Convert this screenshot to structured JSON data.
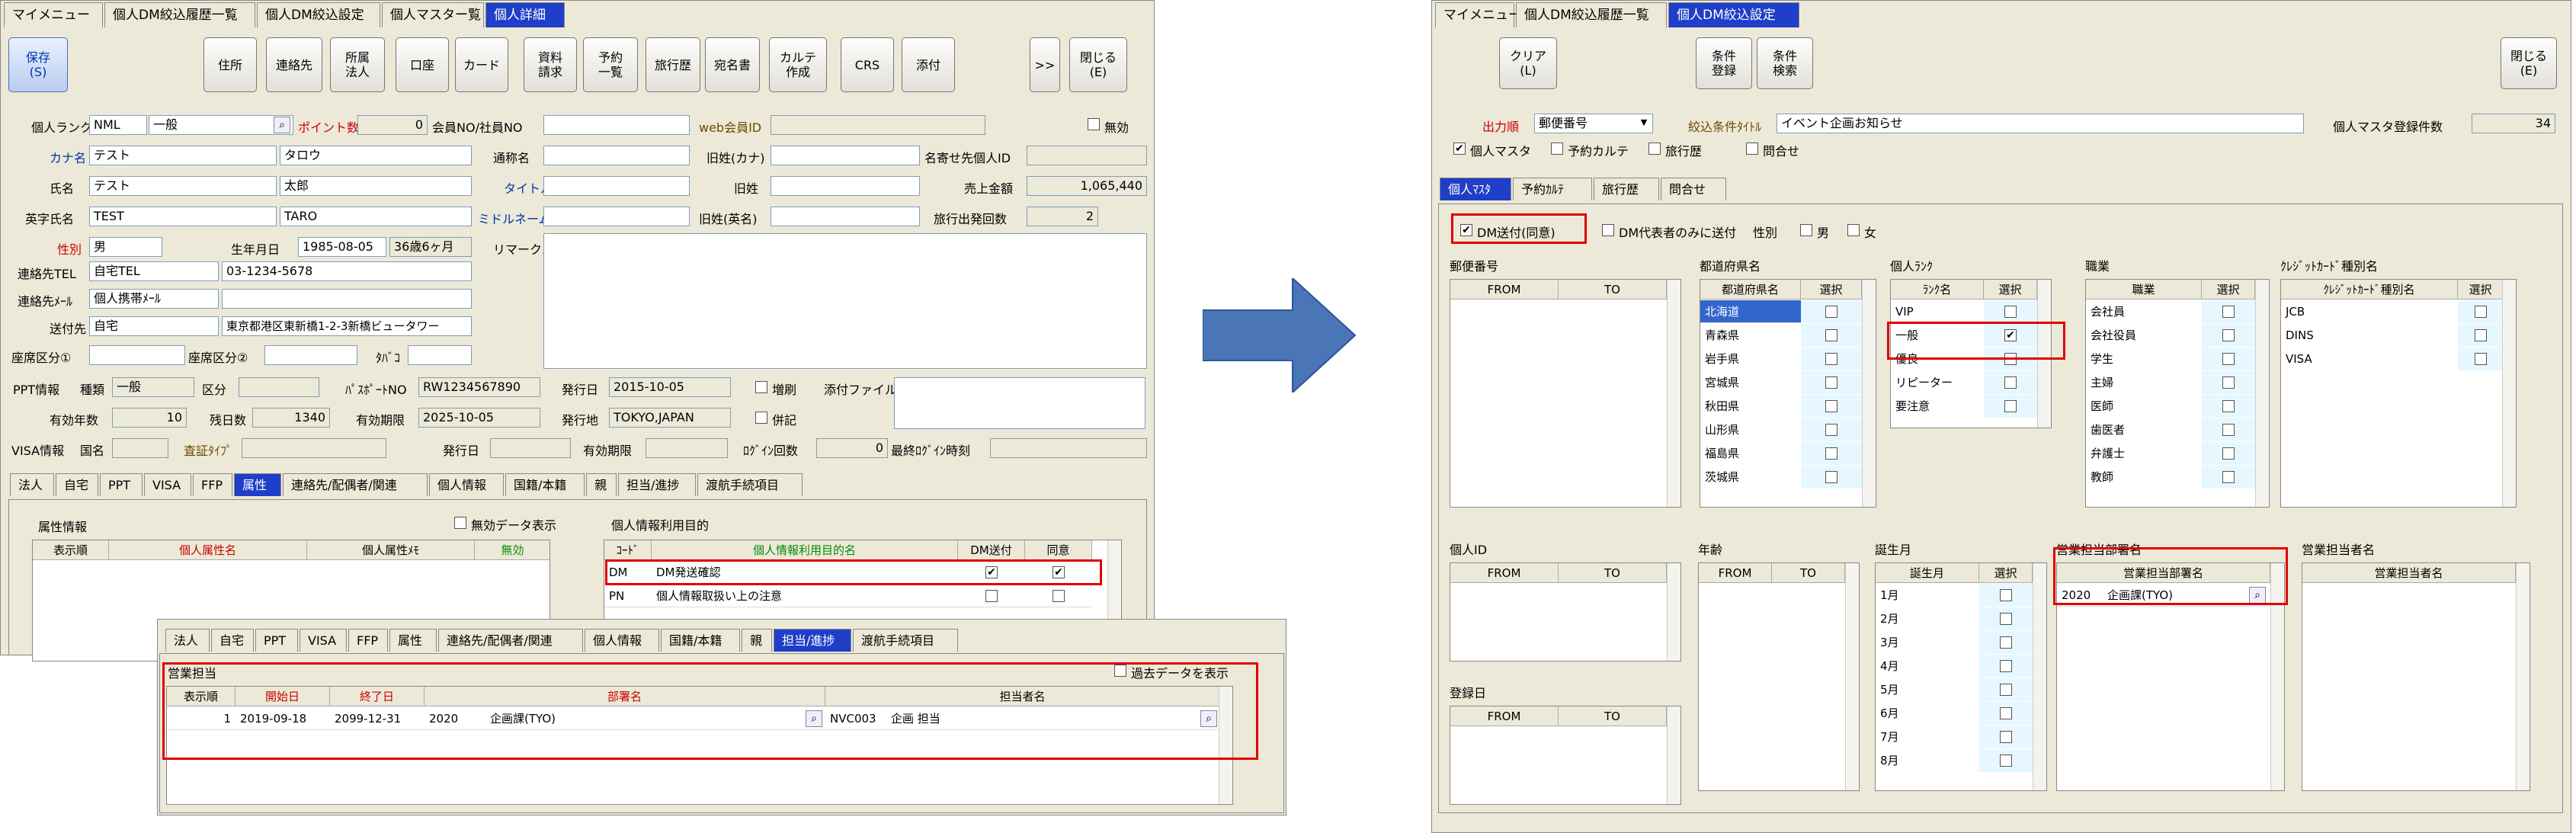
{
  "left": {
    "tabs": [
      "マイメニュー",
      "個人DM絞込履歴一覧",
      "個人DM絞込設定",
      "個人マスター覧",
      "個人詳細"
    ],
    "save": "保存\n(S)",
    "toolbar": [
      "住所",
      "連絡先",
      "所属\n法人",
      "口座",
      "カード",
      "資料\n請求",
      "予約\n一覧",
      "旅行歴",
      "宛名書",
      "カルテ\n作成",
      "CRS",
      "添付",
      ">>",
      "閉じる\n(E)"
    ],
    "form": {
      "rank_label": "個人ランク",
      "rank_code": "NML",
      "rank_name": "一般",
      "point_label": "ポイント数",
      "point_value": "0",
      "member_label": "会員NO/社員NO",
      "web_label": "web会員ID",
      "invalid_label": "無効",
      "kana_label": "カナ名",
      "kana_last": "テスト",
      "kana_first": "タロウ",
      "alias_label": "通称名",
      "old_kana_label": "旧姓(カナ)",
      "nayose_label": "名寄せ先個人ID",
      "name_label": "氏名",
      "name_last": "テスト",
      "name_first": "太郎",
      "title_label": "タイトル",
      "old_label": "旧姓",
      "sales_label": "売上金額",
      "sales_value": "1,065,440",
      "en_label": "英字氏名",
      "en_last": "TEST",
      "en_first": "TARO",
      "middle_label": "ミドルネーム",
      "old_en_label": "旧姓(英名)",
      "travel_label": "旅行出発回数",
      "travel_value": "2",
      "sex_label": "性別",
      "sex_value": "男",
      "birth_label": "生年月日",
      "birth_value": "1985-08-05",
      "age_value": "36歳6ヶ月",
      "remarks_label": "リマークス",
      "tel_label": "連絡先TEL",
      "tel_type": "自宅TEL",
      "tel_value": "03-1234-5678",
      "mail_label": "連絡先ﾒｰﾙ",
      "mail_type": "個人携帯ﾒｰﾙ",
      "send_label": "送付先",
      "send_type": "自宅",
      "send_value": "東京都港区東新橋1-2-3新橋ビュータワー",
      "seat1_label": "座席区分①",
      "seat2_label": "座席区分②",
      "tabako_label": "ﾀﾊﾞｺ",
      "ppt_label": "PPT情報",
      "ppt_kind_label": "種類",
      "ppt_kind": "一般",
      "ppt_cat_label": "区分",
      "passport_label": "ﾊﾟｽﾎﾟｰﾄNO",
      "passport_value": "RW1234567890",
      "issue_label": "発行日",
      "issue_value": "2015-10-05",
      "zoushi_label": "増刷",
      "attach_label": "添付ファイル",
      "years_label": "有効年数",
      "years_value": "10",
      "days_label": "残日数",
      "days_value": "1340",
      "expire_label": "有効期限",
      "expire_value": "2025-10-05",
      "issue_place_label": "発行地",
      "issue_place_value": "TOKYO,JAPAN",
      "heiki_label": "併記",
      "visa_label": "VISA情報",
      "country_label": "国名",
      "visa_type_label": "査証ﾀｲﾌﾟ",
      "visa_issue_label": "発行日",
      "visa_expire_label": "有効期限",
      "login_label": "ﾛｸﾞｲﾝ回数",
      "login_value": "0",
      "last_login_label": "最終ﾛｸﾞｲﾝ時刻"
    },
    "subtabs": [
      "法人",
      "自宅",
      "PPT",
      "VISA",
      "FFP",
      "属性",
      "連絡先/配偶者/関連",
      "個人情報",
      "国籍/本籍",
      "親",
      "担当/進捗",
      "渡航手続項目"
    ],
    "attr": {
      "title": "属性情報",
      "show_invalid": "無効データ表示",
      "cols": [
        "表示順",
        "個人属性名",
        "個人属性ﾒﾓ",
        "無効"
      ]
    },
    "purpose": {
      "title": "個人情報利用目的",
      "cols": [
        "ｺｰﾄﾞ",
        "個人情報利用目的名",
        "DM送付",
        "同意"
      ],
      "rows": [
        {
          "code": "DM",
          "name": "DM発送確認",
          "dm": true,
          "agree": true
        },
        {
          "code": "PN",
          "name": "個人情報取扱い上の注意",
          "dm": false,
          "agree": false
        }
      ]
    }
  },
  "overlay": {
    "subtabs": [
      "法人",
      "自宅",
      "PPT",
      "VISA",
      "FFP",
      "属性",
      "連絡先/配偶者/関連",
      "個人情報",
      "国籍/本籍",
      "親",
      "担当/進捗",
      "渡航手続項目"
    ],
    "title": "営業担当",
    "past": "過去データを表示",
    "cols": [
      "表示順",
      "開始日",
      "終了日",
      "部署名",
      "担当者名"
    ],
    "row": {
      "order": "1",
      "start": "2019-09-18",
      "end": "2099-12-31",
      "dept_code": "2020",
      "dept_name": "企画課(TYO)",
      "staff_code": "NVC003",
      "staff_name": "企画 担当"
    }
  },
  "right": {
    "tabs": [
      "マイメニュー",
      "個人DM絞込履歴一覧",
      "個人DM絞込設定"
    ],
    "clear": "クリア\n(L)",
    "reg": "条件\n登録",
    "search": "条件\n検索",
    "close": "閉じる\n(E)",
    "order_label": "出力順",
    "order_value": "郵便番号",
    "filter_label": "絞込条件ﾀｲﾄﾙ",
    "filter_value": "イベント企画お知らせ",
    "count_label": "個人マスタ登録件数",
    "count_value": "34",
    "checks": [
      {
        "label": "個人マスタ",
        "on": true
      },
      {
        "label": "予約カルテ",
        "on": false
      },
      {
        "label": "旅行歴",
        "on": false
      },
      {
        "label": "問合せ",
        "on": false
      }
    ],
    "subtabs": [
      "個人ﾏｽﾀ",
      "予約ｶﾙﾃ",
      "旅行歴",
      "問合せ"
    ],
    "dm_label": "DM送付(同意)",
    "dm_rep_label": "DM代表者のみに送付",
    "sex_label": "性別",
    "male": "男",
    "female": "女",
    "zip": {
      "title": "郵便番号",
      "cols": [
        "FROM",
        "TO"
      ]
    },
    "pref": {
      "title": "都道府県名",
      "cols": [
        "都道府県名",
        "選択"
      ],
      "rows": [
        "北海道",
        "青森県",
        "岩手県",
        "宮城県",
        "秋田県",
        "山形県",
        "福島県",
        "茨城県"
      ]
    },
    "rank": {
      "title": "個人ﾗﾝｸ",
      "cols": [
        "ﾗﾝｸ名",
        "選択"
      ],
      "rows": [
        {
          "n": "VIP",
          "on": false
        },
        {
          "n": "一般",
          "on": true
        },
        {
          "n": "優良",
          "on": false
        },
        {
          "n": "リピーター",
          "on": false
        },
        {
          "n": "要注意",
          "on": false
        }
      ]
    },
    "job": {
      "title": "職業",
      "cols": [
        "職業",
        "選択"
      ],
      "rows": [
        "会社員",
        "会社役員",
        "学生",
        "主婦",
        "医師",
        "歯医者",
        "弁護士",
        "教師"
      ]
    },
    "card": {
      "title": "ｸﾚｼﾞｯﾄｶｰﾄﾞ種別名",
      "cols": [
        "ｸﾚｼﾞｯﾄｶｰﾄﾞ種別名",
        "選択"
      ],
      "rows": [
        "JCB",
        "DINS",
        "VISA"
      ]
    },
    "pid": {
      "title": "個人ID",
      "cols": [
        "FROM",
        "TO"
      ]
    },
    "age": {
      "title": "年齢",
      "cols": [
        "FROM",
        "TO"
      ]
    },
    "month": {
      "title": "誕生月",
      "cols": [
        "誕生月",
        "選択"
      ],
      "rows": [
        "1月",
        "2月",
        "3月",
        "4月",
        "5月",
        "6月",
        "7月",
        "8月"
      ]
    },
    "dept": {
      "title": "営業担当部署名",
      "cols": [
        "営業担当部署名"
      ],
      "code": "2020",
      "name": "企画課(TYO)"
    },
    "staff": {
      "title": "営業担当者名",
      "cols": [
        "営業担当者名"
      ]
    },
    "reg_date": {
      "title": "登録日",
      "cols": [
        "FROM",
        "TO"
      ]
    }
  },
  "colors": {
    "arrow": "#4a76b8",
    "active_tab": "#1f3fc8",
    "highlight": "#e00000",
    "selected_row": "#3366cc"
  }
}
